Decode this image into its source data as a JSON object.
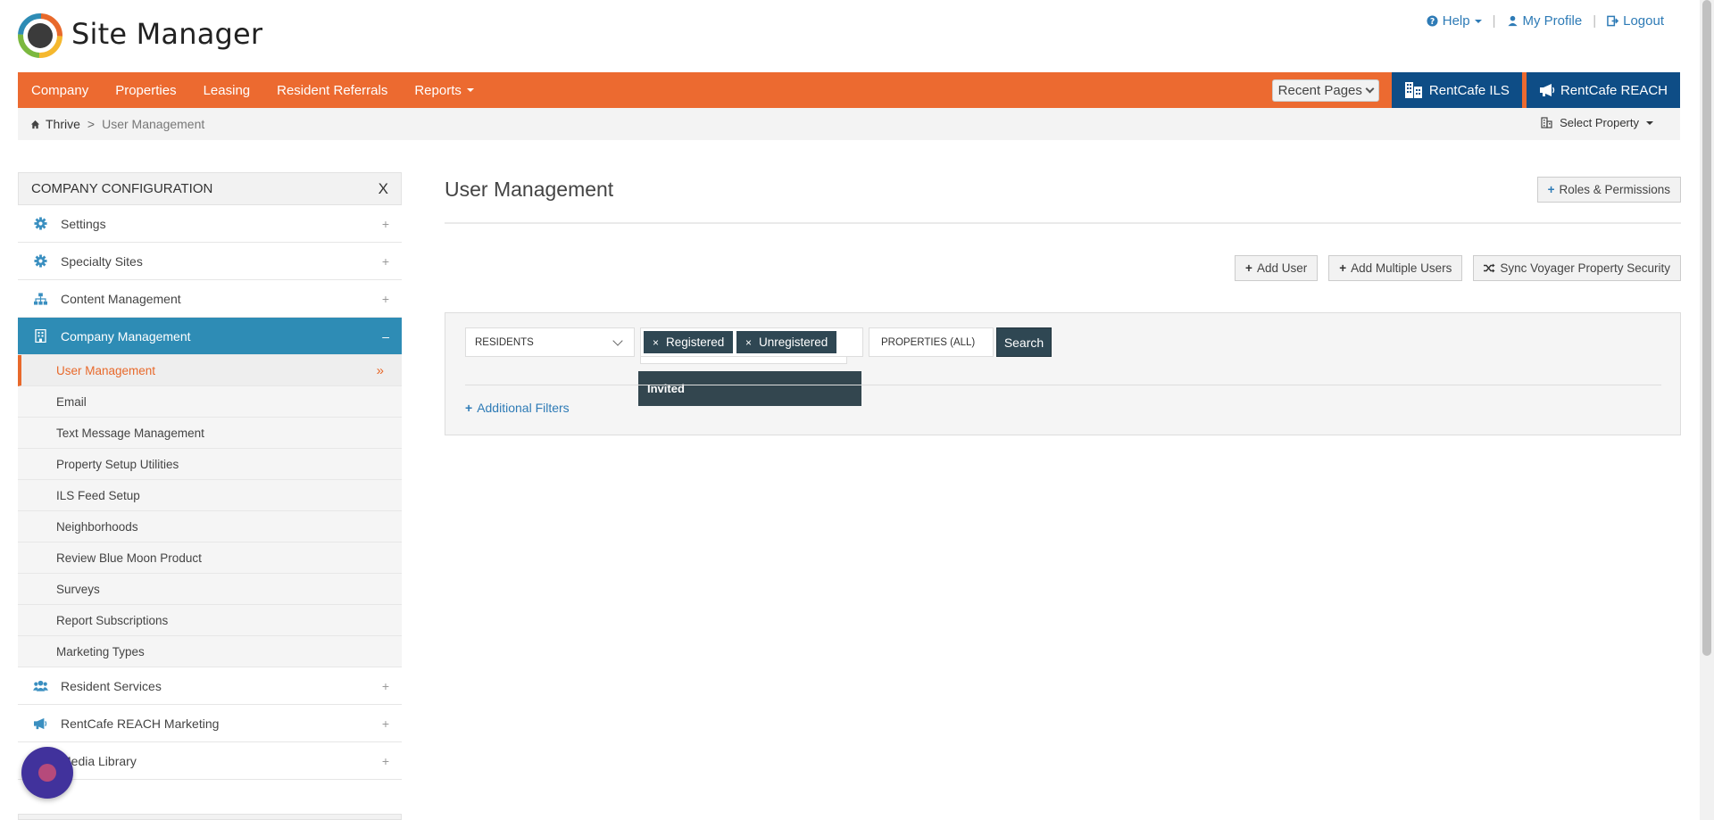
{
  "app": {
    "title": "Site Manager"
  },
  "top_links": {
    "help": "Help",
    "profile": "My Profile",
    "logout": "Logout"
  },
  "nav": {
    "items": [
      "Company",
      "Properties",
      "Leasing",
      "Resident Referrals",
      "Reports"
    ],
    "recent_pages": "Recent Pages",
    "ils": "RentCafe ILS",
    "reach": "RentCafe REACH",
    "accent": "#ec6a30",
    "button_color": "#0e4d86"
  },
  "breadcrumb": {
    "home": "Thrive",
    "separator": ">",
    "current": "User Management",
    "select_property": "Select Property"
  },
  "sidebar": {
    "header": "COMPANY CONFIGURATION",
    "close": "X",
    "items": [
      {
        "label": "Settings",
        "icon": "gear-icon",
        "toggle": "+"
      },
      {
        "label": "Specialty Sites",
        "icon": "gear-icon",
        "toggle": "+"
      },
      {
        "label": "Content Management",
        "icon": "sitemap-icon",
        "toggle": "+"
      },
      {
        "label": "Company Management",
        "icon": "building-icon",
        "toggle": "–"
      }
    ],
    "sub_items": [
      "User Management",
      "Email",
      "Text Message Management",
      "Property Setup Utilities",
      "ILS Feed Setup",
      "Neighborhoods",
      "Review Blue Moon Product",
      "Surveys",
      "Report Subscriptions",
      "Marketing Types"
    ],
    "items_after": [
      {
        "label": "Resident Services",
        "icon": "users-icon",
        "toggle": "+"
      },
      {
        "label": "RentCafe REACH Marketing",
        "icon": "megaphone-icon",
        "toggle": "+"
      },
      {
        "label": "Media Library",
        "icon": "image-icon",
        "toggle": "+"
      }
    ],
    "active_color": "#2e8cb5"
  },
  "main": {
    "title": "User Management",
    "roles_button": "Roles & Permissions",
    "actions": [
      "Add User",
      "Add Multiple Users",
      "Sync Voyager Property Security"
    ],
    "filters": {
      "user_type": "RESIDENTS",
      "status_tags": [
        "Registered",
        "Unregistered"
      ],
      "dropdown_option": "Invited",
      "properties": "PROPERTIES (ALL)",
      "search": "Search",
      "additional_filters": "Additional Filters"
    }
  }
}
